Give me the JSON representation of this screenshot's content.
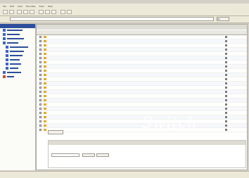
{
  "menubar": {
    "items": [
      "File",
      "Edit",
      "View",
      "Favorites",
      "Tools",
      "Help"
    ]
  },
  "address": {
    "go_label": "Go"
  },
  "sidebar": {
    "header": "",
    "items": [
      {
        "label": ""
      },
      {
        "label": ""
      },
      {
        "label": ""
      },
      {
        "label": ""
      },
      {
        "label": ""
      },
      {
        "label": ""
      },
      {
        "label": ""
      },
      {
        "label": ""
      },
      {
        "label": ""
      },
      {
        "label": ""
      },
      {
        "label": ""
      },
      {
        "label": ""
      },
      {
        "label": ""
      }
    ]
  },
  "main": {
    "panel_title": "",
    "columns": [
      "",
      "",
      ""
    ],
    "rows": [
      {
        "name": "",
        "status": ""
      },
      {
        "name": "",
        "status": ""
      },
      {
        "name": "",
        "status": ""
      },
      {
        "name": "",
        "status": ""
      },
      {
        "name": "",
        "status": ""
      },
      {
        "name": "",
        "status": ""
      },
      {
        "name": "",
        "status": ""
      },
      {
        "name": "",
        "status": ""
      },
      {
        "name": "",
        "status": ""
      },
      {
        "name": "",
        "status": ""
      },
      {
        "name": "",
        "status": ""
      },
      {
        "name": "",
        "status": ""
      },
      {
        "name": "",
        "status": ""
      },
      {
        "name": "",
        "status": ""
      },
      {
        "name": "",
        "status": ""
      },
      {
        "name": "",
        "status": ""
      },
      {
        "name": "",
        "status": ""
      },
      {
        "name": "",
        "status": ""
      },
      {
        "name": "",
        "status": ""
      },
      {
        "name": "",
        "status": ""
      },
      {
        "name": "",
        "status": ""
      },
      {
        "name": "",
        "status": ""
      },
      {
        "name": "",
        "status": ""
      },
      {
        "name": "",
        "status": ""
      },
      {
        "name": "",
        "status": ""
      }
    ],
    "action_button": "",
    "sub_panel_title": "",
    "sub_buttons": [
      "",
      ""
    ]
  },
  "watermark": "Switch",
  "statusbar": {
    "text": "",
    "zone": ""
  },
  "colors": {
    "accent": "#2d4f9a",
    "folder": "#e2a928"
  }
}
